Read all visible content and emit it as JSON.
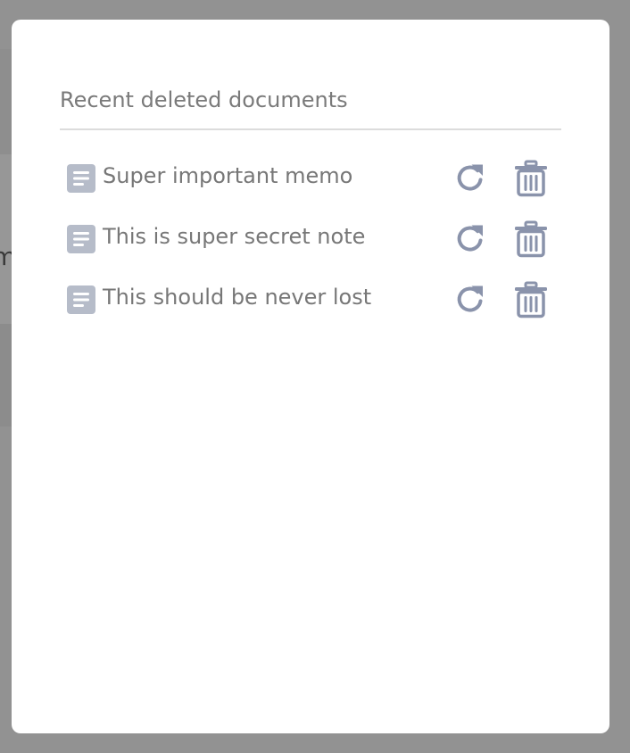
{
  "background": {
    "partial_glyph": "m"
  },
  "modal": {
    "title": "Recent deleted documents",
    "documents": [
      {
        "name": "Super important memo"
      },
      {
        "name": "This is super secret note"
      },
      {
        "name": "This should be never lost"
      }
    ]
  },
  "icons": {
    "document": "document-icon",
    "restore": "restore-icon",
    "delete": "trash-icon"
  },
  "colors": {
    "overlay": "#929292",
    "modal_bg": "#ffffff",
    "title_text": "#7a7a7a",
    "doc_text": "#777777",
    "doc_icon": "#b6bcc9",
    "action_icon": "#8a93ab",
    "divider": "#dcdcdc"
  }
}
